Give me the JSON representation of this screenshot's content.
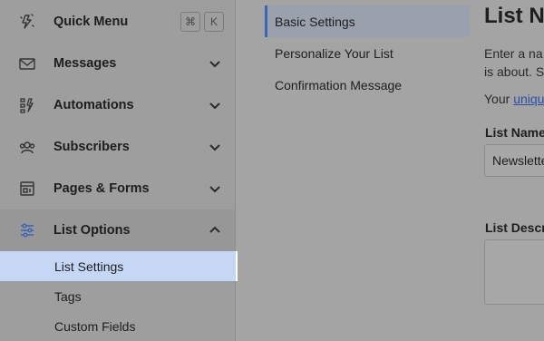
{
  "sidebar": {
    "shortcut_keys": [
      "⌘",
      "K"
    ],
    "items": [
      {
        "label": "Quick Menu",
        "icon": "quick-menu-icon"
      },
      {
        "label": "Messages",
        "icon": "envelope-icon"
      },
      {
        "label": "Automations",
        "icon": "automation-icon"
      },
      {
        "label": "Subscribers",
        "icon": "subscribers-icon"
      },
      {
        "label": "Pages & Forms",
        "icon": "pages-forms-icon"
      },
      {
        "label": "List Options",
        "icon": "sliders-icon"
      }
    ],
    "sub_items": [
      {
        "label": "List Settings",
        "active": true
      },
      {
        "label": "Tags"
      },
      {
        "label": "Custom Fields"
      }
    ]
  },
  "tabs": [
    {
      "label": "Basic Settings",
      "active": true
    },
    {
      "label": "Personalize Your List"
    },
    {
      "label": "Confirmation Message"
    }
  ],
  "main": {
    "title": "List N",
    "desc_line1": "Enter a na",
    "desc_line2": "is about. S",
    "unique_prefix": "Your ",
    "unique_link": "uniqu",
    "list_name_label": "List Name",
    "list_name_value": "Newslette",
    "list_desc_label": "List Descr"
  },
  "colors": {
    "accent": "#3a64b8",
    "active_sub_bg": "#c5d7f5",
    "link": "#2a4ea5"
  }
}
